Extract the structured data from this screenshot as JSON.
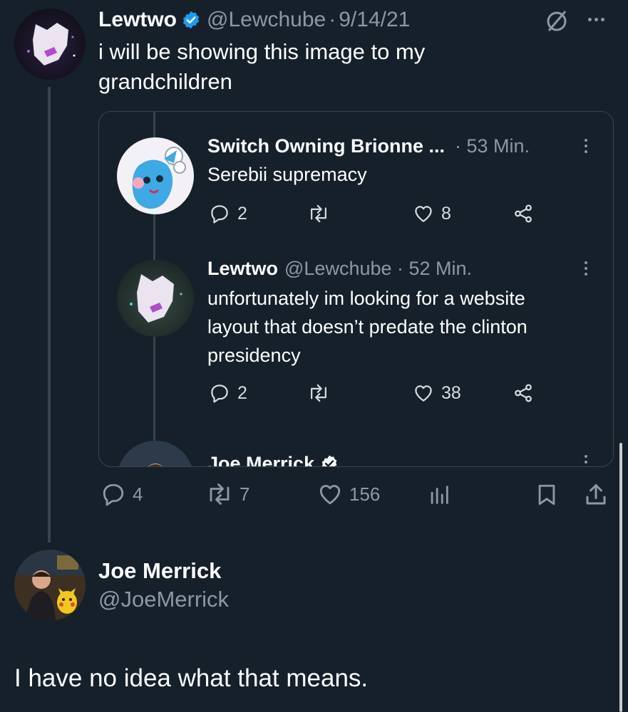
{
  "main_tweet": {
    "author_name": "Lewtwo",
    "handle": "@Lewchube",
    "date_sep": "·",
    "date": "9/14/21",
    "text_line1": "i will be showing this image to my",
    "text_line2": "grandchildren",
    "actions": {
      "replies": "4",
      "retweets": "7",
      "likes": "156"
    }
  },
  "embedded": {
    "tweet1": {
      "author_name": "Switch Owning Brionne ...",
      "time": "· 53 Min.",
      "text": "Serebii supremacy",
      "replies": "2",
      "likes": "8"
    },
    "tweet2": {
      "author_name": "Lewtwo",
      "handle_time": "@Lewchube · 52 Min.",
      "text_line1": "unfortunately im looking for a website",
      "text_line2": "layout that doesn’t predate the clinton",
      "text_line3": "presidency",
      "replies": "2",
      "likes": "38"
    },
    "tweet3": {
      "author_name": "Joe Merrick"
    }
  },
  "reply": {
    "author_name": "Joe Merrick",
    "handle": "@JoeMerrick",
    "text": "I have no idea what that means."
  },
  "colors": {
    "background": "#15202b",
    "verified": "#1d9bf0",
    "muted": "#8b98a5",
    "border": "#38444d"
  }
}
